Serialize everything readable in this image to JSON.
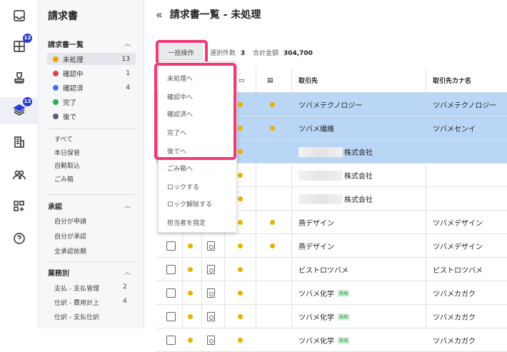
{
  "rail": {
    "items": [
      {
        "name": "inbox-icon",
        "badge": ""
      },
      {
        "name": "columns-icon",
        "badge": "12"
      },
      {
        "name": "stamp-icon",
        "badge": ""
      },
      {
        "name": "layers-icon",
        "badge": "13"
      },
      {
        "name": "building-icon",
        "badge": ""
      },
      {
        "name": "people-icon",
        "badge": ""
      },
      {
        "name": "apps-add-icon",
        "badge": ""
      },
      {
        "name": "help-icon",
        "badge": ""
      }
    ]
  },
  "sidebar": {
    "title": "請求書",
    "section1": "請求書一覧",
    "statuses": [
      {
        "label": "未処理",
        "count": "13",
        "color": "#e8a800"
      },
      {
        "label": "確認中",
        "count": "1",
        "color": "#e04545"
      },
      {
        "label": "確認済",
        "count": "4",
        "color": "#3b7be0"
      },
      {
        "label": "完了",
        "count": "",
        "color": "#2fae55"
      },
      {
        "label": "後で",
        "count": "",
        "color": "#5a6070"
      }
    ],
    "links": [
      "すべて",
      "本日保管",
      "自動取込",
      "ごみ箱"
    ],
    "section2": "承認",
    "approval": [
      "自分が申請",
      "自分が承認",
      "全承認依頼"
    ],
    "section3": "業務別",
    "business": [
      {
        "label": "支払 - 支払管理",
        "count": "2"
      },
      {
        "label": "仕訳 - 費用計上",
        "count": "4"
      },
      {
        "label": "仕訳 - 支払仕訳",
        "count": ""
      }
    ]
  },
  "header": {
    "back": "«",
    "title": "請求書一覧 - 未処理"
  },
  "toolbar": {
    "bulk_label": "一括操作",
    "selected_label": "選択件数",
    "selected_count": "3",
    "total_label": "合計金額",
    "total_value": "304,700"
  },
  "bulk_menu": [
    "未処理へ",
    "確認中へ",
    "確認済へ",
    "完了へ",
    "後でへ",
    "ごみ箱へ",
    "ロックする",
    "ロック解除する",
    "担当者を指定"
  ],
  "table": {
    "headers": {
      "partner": "取引先",
      "partner_kana": "取引先カナ名"
    },
    "rows": [
      {
        "partner": "ツバメテクノロジー",
        "kana": "ツバメテクノロジー",
        "tag": "",
        "dot2": true,
        "hl": true,
        "blur": false
      },
      {
        "partner": "ツバメ繊維",
        "kana": "ツバメセンイ",
        "tag": "",
        "dot2": true,
        "hl": true,
        "blur": false
      },
      {
        "partner": "株式会社",
        "kana": "",
        "tag": "",
        "dot2": false,
        "hl": true,
        "blur": true
      },
      {
        "partner": "株式会社",
        "kana": "",
        "tag": "",
        "dot2": false,
        "hl": false,
        "blur": true
      },
      {
        "partner": "株式会社",
        "kana": "",
        "tag": "",
        "dot2": false,
        "hl": false,
        "blur": true
      },
      {
        "partner": "燕デザイン",
        "kana": "ツバメデザイン",
        "tag": "",
        "dot2": true,
        "hl": false,
        "blur": false
      },
      {
        "partner": "燕デザイン",
        "kana": "ツバメデザイン",
        "tag": "",
        "dot2": true,
        "hl": false,
        "blur": false
      },
      {
        "partner": "ビストロツバメ",
        "kana": "ビストロツバメ",
        "tag": "",
        "dot2": false,
        "hl": false,
        "blur": false
      },
      {
        "partner": "ツバメ化学",
        "kana": "ツバメカガク",
        "tag": "適格",
        "dot2": false,
        "hl": false,
        "blur": false
      },
      {
        "partner": "ツバメ化学",
        "kana": "ツバメカガク",
        "tag": "適格",
        "dot2": false,
        "hl": false,
        "blur": false
      },
      {
        "partner": "ツバメ化学",
        "kana": "ツバメカガク",
        "tag": "適格",
        "dot2": false,
        "hl": false,
        "blur": false
      }
    ]
  }
}
